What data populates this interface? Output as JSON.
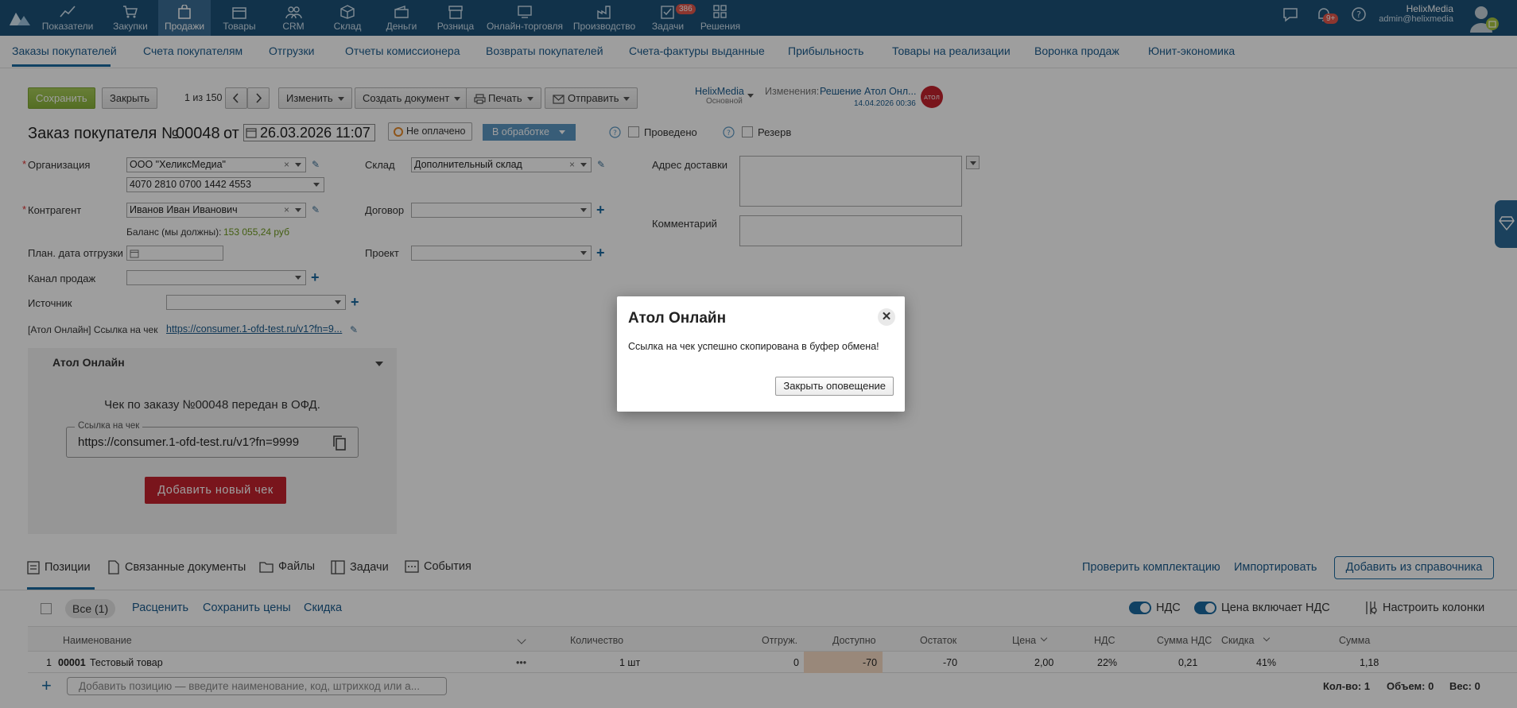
{
  "topnav": {
    "items": [
      {
        "label": "Показатели"
      },
      {
        "label": "Закупки"
      },
      {
        "label": "Продажи"
      },
      {
        "label": "Товары"
      },
      {
        "label": "CRM"
      },
      {
        "label": "Склад"
      },
      {
        "label": "Деньги"
      },
      {
        "label": "Розница"
      },
      {
        "label": "Онлайн-торговля"
      },
      {
        "label": "Производство"
      },
      {
        "label": "Задачи"
      },
      {
        "label": "Решения"
      }
    ],
    "tasks_badge": "386",
    "notifications_badge": "9+",
    "user_name": "HelixMedia",
    "user_email": "admin@helixmedia"
  },
  "subnav": {
    "items": [
      "Заказы покупателей",
      "Счета покупателям",
      "Отгрузки",
      "Отчеты комиссионера",
      "Возвраты покупателей",
      "Счета-фактуры выданные",
      "Прибыльность",
      "Товары на реализации",
      "Воронка продаж",
      "Юнит-экономика"
    ]
  },
  "toolbar": {
    "save": "Сохранить",
    "close": "Закрыть",
    "pager": "1 из 150",
    "edit": "Изменить",
    "create_doc": "Создать документ",
    "print": "Печать",
    "send": "Отправить",
    "company": "HelixMedia",
    "company_sub": "Основной",
    "changes_label": "Изменения:",
    "changes_value": "Решение Атол Онл...",
    "changes_date": "14.04.2026 00:36"
  },
  "doc": {
    "title": "Заказ покупателя №",
    "number": "00048",
    "from": "от",
    "date": "26.03.2026 11:07",
    "payment_status": "Не оплачено",
    "state": "В обработке",
    "posted": "Проведено",
    "reserve": "Резерв"
  },
  "form": {
    "org_label": "Организация",
    "org_value": "ООО \"ХеликсМедиа\"",
    "account_value": "4070 2810 0700 1442 4553",
    "contractor_label": "Контрагент",
    "contractor_value": "Иванов Иван Иванович",
    "balance_label": "Баланс (мы должны):",
    "balance_value": "153 055,24 руб",
    "ship_date_label": "План. дата отгрузки",
    "channel_label": "Канал продаж",
    "source_label": "Источник",
    "atol_link_label": "[Атол Онлайн] Ссылка на чек",
    "atol_link_value": "https://consumer.1-ofd-test.ru/v1?fn=9...",
    "warehouse_label": "Склад",
    "warehouse_value": "Дополнительный склад",
    "contract_label": "Договор",
    "project_label": "Проект",
    "address_label": "Адрес доставки",
    "comment_label": "Комментарий"
  },
  "atol_panel": {
    "title": "Атол Онлайн",
    "status": "Чек по заказу №00048 передан в ОФД.",
    "link_legend": "Ссылка на чек",
    "link_value": "https://consumer.1-ofd-test.ru/v1?fn=9999",
    "add_button": "Добавить новый чек"
  },
  "tabs": {
    "items": [
      "Позиции",
      "Связанные документы",
      "Файлы",
      "Задачи",
      "События"
    ],
    "check_kit": "Проверить комплектацию",
    "import": "Импортировать",
    "add_from_catalog": "Добавить из справочника"
  },
  "positions_toolbar": {
    "all": "Все (1)",
    "reprice": "Расценить",
    "save_prices": "Сохранить цены",
    "discount": "Скидка",
    "vat": "НДС",
    "price_incl_vat": "Цена включает НДС",
    "columns": "Настроить колонки"
  },
  "table": {
    "headers": [
      "Наименование",
      "Количество",
      "Отгруж.",
      "Доступно",
      "Остаток",
      "Цена",
      "НДС",
      "Сумма НДС",
      "Скидка",
      "Сумма"
    ],
    "rows": [
      {
        "num": "1",
        "code": "00001",
        "name": "Тестовый товар",
        "qty": "1 шт",
        "shipped": "0",
        "available": "-70",
        "stock": "-70",
        "price": "2,00",
        "vat": "22%",
        "vat_sum": "0,21",
        "discount": "41%",
        "sum": "1,18"
      }
    ],
    "add_placeholder": "Добавить позицию — введите наименование, код, штрихкод или а...",
    "footer_qty": "Кол-во: 1",
    "footer_volume": "Объем: 0",
    "footer_weight": "Вес: 0"
  },
  "dialog": {
    "title": "Атол Онлайн",
    "message": "Ссылка на чек успешно скопирована в буфер обмена!",
    "button": "Закрыть оповещение"
  },
  "colors": {
    "topbar": "#1c5278",
    "accent": "#1b6aa0",
    "save_green": "#97bf47",
    "danger_red": "#c4222e",
    "state_blue": "#5b96c2"
  }
}
